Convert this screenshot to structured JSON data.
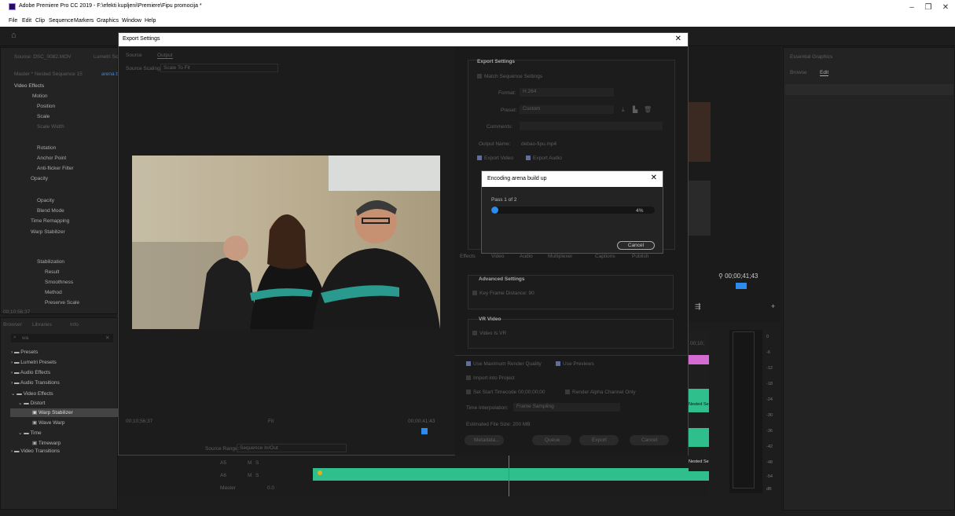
{
  "app": {
    "title": "Adobe Premiere Pro CC 2019 - F:\\efekti kupljeni\\Premiere\\Fipu promocija *",
    "menu": [
      "File",
      "Edit",
      "Clip",
      "Sequence",
      "Markers",
      "Graphics",
      "Window",
      "Help"
    ]
  },
  "effect_controls": {
    "source_tab": "Source: DSC_0082.MOV",
    "lumetri_tab": "Lumetri Sc",
    "master": "Master * Nested Sequence 15",
    "clip": "arena b",
    "video_effects": "Video Effects",
    "items": [
      "Motion",
      "Position",
      "Scale",
      "Scale Width",
      "Rotation",
      "Anchor Point",
      "Anti-flicker Filter",
      "Opacity",
      "Opacity",
      "Blend Mode",
      "Time Remapping",
      "Warp Stabilizer",
      "Stabilization",
      "Result",
      "Smoothness",
      "Method",
      "Preserve Scale"
    ],
    "timecode": "00;10;56;37"
  },
  "project_panel": {
    "tabs": [
      "Browser",
      "Libraries",
      "Info"
    ],
    "search": "wa",
    "tree": [
      "Presets",
      "Lumetri Presets",
      "Audio Effects",
      "Audio Transitions",
      "Video Effects",
      "Distort",
      "Warp Stabilizer",
      "Wave Warp",
      "Time",
      "Timewarp",
      "Video Transitions"
    ]
  },
  "export_settings": {
    "title": "Export Settings",
    "tabs": [
      "Source",
      "Output"
    ],
    "source_scaling_label": "Source Scaling:",
    "source_scaling_value": "Scale To Fit",
    "timecode_left": "00;10;56;37",
    "timecode_right": "00;00;41;43",
    "fit": "Fit",
    "source_range_label": "Source Range:",
    "source_range_value": "Sequence In/Out",
    "section_title": "Export Settings",
    "match_sequence": "Match Sequence Settings",
    "format_label": "Format:",
    "format_value": "H.264",
    "preset_label": "Preset:",
    "preset_value": "Custom",
    "comments_label": "Comments:",
    "output_name_label": "Output Name:",
    "output_name_value": "debao-fipu.mp4",
    "export_video": "Export Video",
    "export_audio": "Export Audio",
    "tabs_bottom": [
      "Effects",
      "Video",
      "Audio",
      "Multiplexer",
      "Captions",
      "Publish"
    ],
    "advanced_title": "Advanced Settings",
    "key_frame": "Key Frame Distance:",
    "key_frame_value": "90",
    "vr_title": "VR Video",
    "video_is_vr": "Video Is VR",
    "max_render": "Use Maximum Render Quality",
    "use_previews": "Use Previews",
    "import_project": "Import into Project",
    "set_start_tc": "Set Start Timecode",
    "start_tc_value": "00;00;00;00",
    "render_alpha": "Render Alpha Channel Only",
    "time_interp_label": "Time Interpolation:",
    "time_interp_value": "Frame Sampling",
    "file_size": "Estimated File Size: 200 MB",
    "buttons": [
      "Metadata...",
      "Queue",
      "Export",
      "Cancel"
    ]
  },
  "encoding": {
    "title": "Encoding arena build up",
    "pass": "Pass 1 of 2",
    "percent": "4%",
    "progress": 0.04,
    "cancel": "Cancel"
  },
  "right": {
    "panel_title": "Essential Graphics",
    "tabs": [
      "Browse",
      "Edit"
    ],
    "program_timecode": "00;00;41;43",
    "seq_tc": "00;10;",
    "clip_label": "Nested Se",
    "clip_label2": "Nested Se",
    "meter_ticks": [
      "0",
      "-6",
      "-12",
      "-18",
      "-24",
      "-30",
      "-36",
      "-42",
      "-48",
      "-54",
      "dB"
    ]
  },
  "timeline": {
    "tracks": [
      "A5",
      "A6",
      "Master"
    ],
    "master_value": "0.0",
    "track_controls": [
      "M",
      "S"
    ]
  },
  "colors": {
    "accent": "#2d8ceb",
    "audio_clip": "#2fbf8c",
    "pink_clip": "#d36bd3"
  }
}
